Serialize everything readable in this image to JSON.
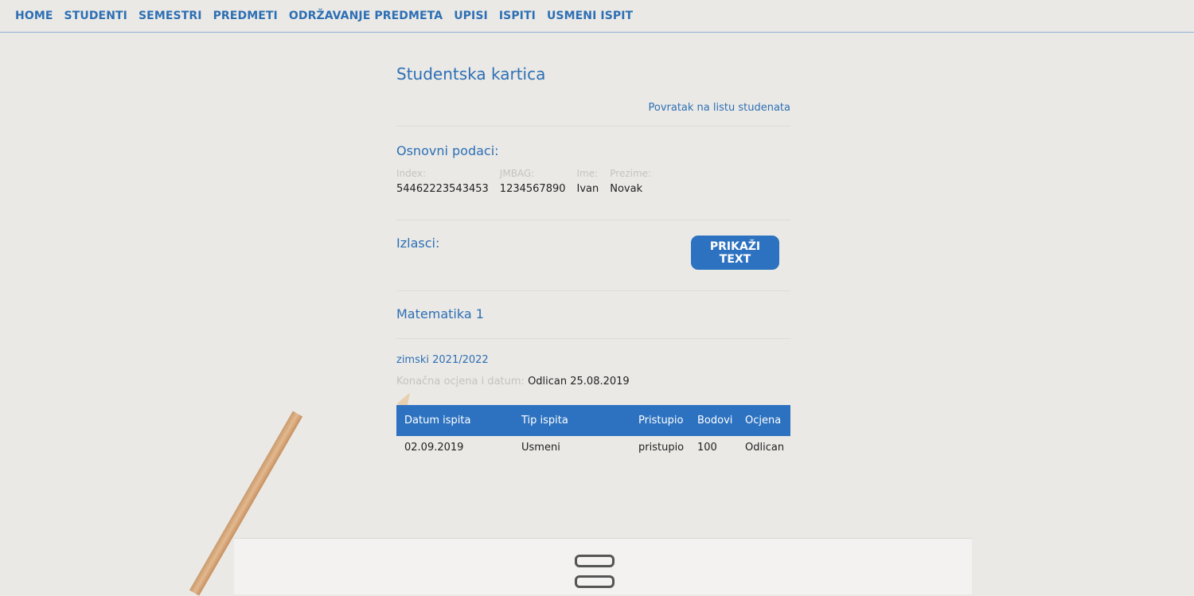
{
  "nav": {
    "items": [
      "HOME",
      "STUDENTI",
      "SEMESTRI",
      "PREDMETI",
      "ODRŽAVANJE PREDMETA",
      "UPISI",
      "ISPITI",
      "USMENI ISPIT"
    ]
  },
  "page": {
    "title": "Studentska kartica",
    "back_link": "Povratak na listu studenata"
  },
  "basic": {
    "heading": "Osnovni podaci:",
    "fields": [
      {
        "label": "Index:",
        "value": "54462223543453"
      },
      {
        "label": "JMBAG:",
        "value": "1234567890"
      },
      {
        "label": "Ime:",
        "value": "Ivan"
      },
      {
        "label": "Prezime:",
        "value": "Novak"
      }
    ]
  },
  "attempts": {
    "heading": "Izlasci:",
    "button_label": "PRIKAŽI TEXT"
  },
  "course": {
    "name": "Matematika 1",
    "semester": "zimski 2021/2022",
    "final_label": "Konačna ocjena i datum:",
    "final_value": "Odlican 25.08.2019",
    "table": {
      "headers": [
        "Datum ispita",
        "Tip ispita",
        "Pristupio",
        "Bodovi",
        "Ocjena"
      ],
      "rows": [
        [
          "02.09.2019",
          "Usmeni",
          "pristupio",
          "100",
          "Odlican"
        ]
      ]
    }
  },
  "colors": {
    "accent": "#2d6fb4",
    "button": "#2d72c0",
    "background": "#eae9e6"
  }
}
